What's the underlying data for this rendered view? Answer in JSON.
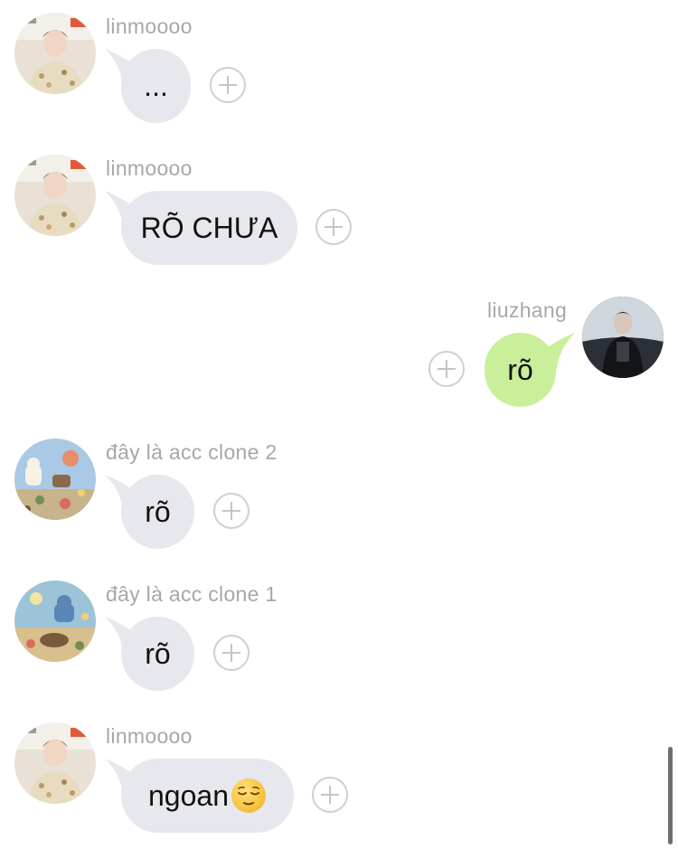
{
  "messages": [
    {
      "sender": "linmoooo",
      "text": "...",
      "side": "in",
      "avatar": "avatar-photo-man"
    },
    {
      "sender": "linmoooo",
      "text": "RÕ CHƯA",
      "side": "in",
      "avatar": "avatar-photo-man"
    },
    {
      "sender": "liuzhang",
      "text": "rõ",
      "side": "out",
      "avatar": "avatar-photo-dark"
    },
    {
      "sender": "đây là acc clone 2",
      "text": "rõ",
      "side": "in",
      "avatar": "avatar-illustration-1"
    },
    {
      "sender": "đây là acc clone 1",
      "text": "rõ",
      "side": "in",
      "avatar": "avatar-illustration-2"
    },
    {
      "sender": "linmoooo",
      "text": "ngoan",
      "emoji": "relieved-face-emoji",
      "side": "in",
      "avatar": "avatar-photo-man"
    }
  ],
  "colors": {
    "incoming_bubble": "#e6e8ee",
    "outgoing_bubble": "#c9ef9a",
    "sender_name": "#a7a7ab",
    "react_button": "#c4c4c8"
  },
  "icons": {
    "react_button": "plus-circle-icon"
  }
}
